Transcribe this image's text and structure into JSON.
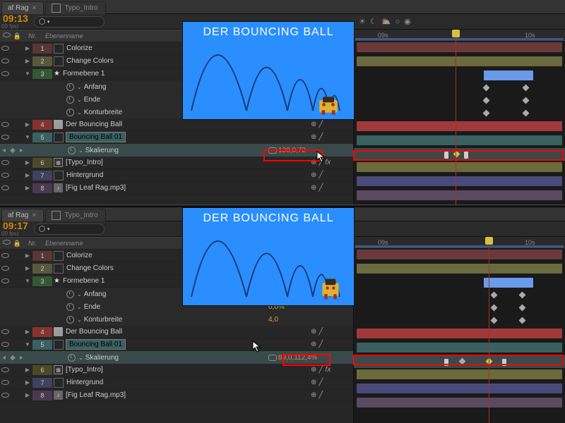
{
  "tabs": {
    "active": "af Rag",
    "inactive": "Typo_Intro"
  },
  "top": {
    "timecode": "09:13",
    "fps": "00 fps)",
    "preview_title": "DER BOUNCING BALL",
    "hdr_nr": "Nr.",
    "hdr_name": "Ebenenname",
    "layers": [
      {
        "nr": "1",
        "name": "Colorize",
        "cls": "c1",
        "icon": "swatch"
      },
      {
        "nr": "2",
        "name": "Change Colors",
        "cls": "c2",
        "icon": "swatch"
      },
      {
        "nr": "3",
        "name": "Formebene 1",
        "cls": "c3",
        "icon": "star",
        "expanded": true,
        "props": [
          {
            "name": "Anfang"
          },
          {
            "name": "Ende"
          },
          {
            "name": "Konturbreite"
          }
        ]
      },
      {
        "nr": "4",
        "name": "Der Bouncing Ball",
        "cls": "c4",
        "icon": "doc"
      },
      {
        "nr": "5",
        "name": "Bouncing Ball 01",
        "cls": "c5",
        "icon": "swatch",
        "expanded": true,
        "highlight_name": true,
        "props": [
          {
            "name": "Skalierung",
            "value": "138,0,72",
            "highlight": true
          }
        ]
      },
      {
        "nr": "6",
        "name": "[Typo_Intro]",
        "cls": "c6",
        "icon": "comp"
      },
      {
        "nr": "7",
        "name": "Hintergrund",
        "cls": "c7",
        "icon": "swatch"
      },
      {
        "nr": "8",
        "name": "[Fig Leaf Rag.mp3]",
        "cls": "c8",
        "icon": "mp3"
      }
    ],
    "ruler": {
      "t1": "09s",
      "t2": "10s"
    }
  },
  "bottom": {
    "timecode": "09:17",
    "fps": "00 fps)",
    "preview_title": "DER BOUNCING BALL",
    "hdr_nr": "Nr.",
    "hdr_name": "Ebenenname",
    "layers": [
      {
        "nr": "1",
        "name": "Colorize",
        "cls": "c1",
        "icon": "swatch"
      },
      {
        "nr": "2",
        "name": "Change Colors",
        "cls": "c2",
        "icon": "swatch"
      },
      {
        "nr": "3",
        "name": "Formebene 1",
        "cls": "c3",
        "icon": "star",
        "expanded": true,
        "props": [
          {
            "name": "Anfang",
            "value": ""
          },
          {
            "name": "Ende",
            "value": "0,0%"
          },
          {
            "name": "Konturbreite",
            "value": "4,0"
          }
        ]
      },
      {
        "nr": "4",
        "name": "Der Bouncing Ball",
        "cls": "c4",
        "icon": "doc"
      },
      {
        "nr": "5",
        "name": "Bouncing Ball 01",
        "cls": "c5",
        "icon": "swatch",
        "expanded": true,
        "highlight_name": true,
        "props": [
          {
            "name": "Skalierung",
            "value": "89,0,112,4%",
            "highlight": true
          }
        ]
      },
      {
        "nr": "6",
        "name": "[Typo_Intro]",
        "cls": "c6",
        "icon": "comp"
      },
      {
        "nr": "7",
        "name": "Hintergrund",
        "cls": "c7",
        "icon": "swatch"
      },
      {
        "nr": "8",
        "name": "[Fig Leaf Rag.mp3]",
        "cls": "c8",
        "icon": "mp3"
      }
    ],
    "ruler": {
      "t1": "09s",
      "t2": "10s"
    }
  }
}
